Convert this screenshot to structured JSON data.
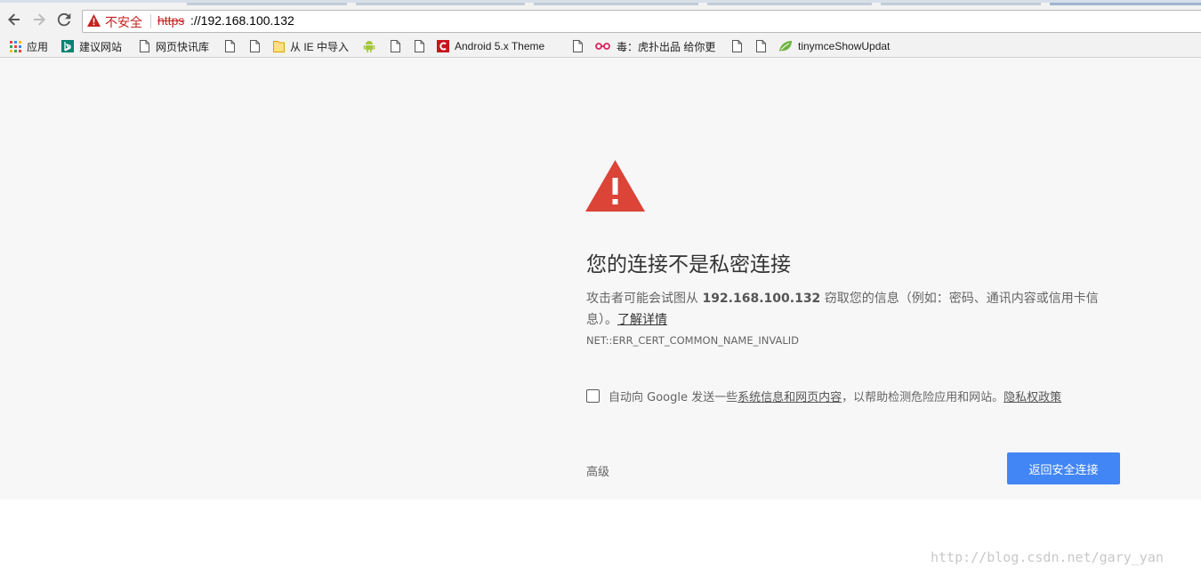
{
  "omnibox": {
    "security_label": "不安全",
    "scheme": "https",
    "url_rest": "://192.168.100.132"
  },
  "bookmarks": {
    "items": [
      {
        "label": "应用",
        "icon": "apps-grid-icon"
      },
      {
        "label": "建议网站",
        "icon": "bing-icon"
      },
      {
        "label": "网页快讯库",
        "icon": "page-icon"
      },
      {
        "label": "",
        "icon": "page-icon"
      },
      {
        "label": "",
        "icon": "page-icon"
      },
      {
        "label": "从 IE 中导入",
        "icon": "folder-icon"
      },
      {
        "label": "",
        "icon": "android-icon"
      },
      {
        "label": "",
        "icon": "page-icon"
      },
      {
        "label": "",
        "icon": "page-icon"
      },
      {
        "label": "Android 5.x Theme",
        "icon": "csdn-icon"
      },
      {
        "label": "",
        "icon": "page-icon"
      },
      {
        "label": "毒：虎扑出品 给你更",
        "icon": "dudu-icon"
      },
      {
        "label": "",
        "icon": "page-icon"
      },
      {
        "label": "",
        "icon": "page-icon"
      },
      {
        "label": "tinymceShowUpdat",
        "icon": "leaf-icon"
      }
    ]
  },
  "interstitial": {
    "heading": "您的连接不是私密连接",
    "desc_prefix": "攻击者可能会试图从 ",
    "desc_host": "192.168.100.132",
    "desc_suffix": " 窃取您的信息（例如：密码、通讯内容或信用卡信息）。",
    "learn_more": "了解详情",
    "error_code": "NET::ERR_CERT_COMMON_NAME_INVALID",
    "opt_in_prefix": "自动向 Google 发送一些",
    "opt_in_link": "系统信息和网页内容",
    "opt_in_middle": "，以帮助检测危险应用和网站。",
    "privacy_link": "隐私权政策",
    "advanced_label": "高级",
    "back_button_label": "返回安全连接"
  },
  "watermark": "http://blog.csdn.net/gary_yan",
  "colors": {
    "warning_red": "#db4437",
    "primary_blue": "#4285f4",
    "page_background": "#f7f7f7"
  }
}
